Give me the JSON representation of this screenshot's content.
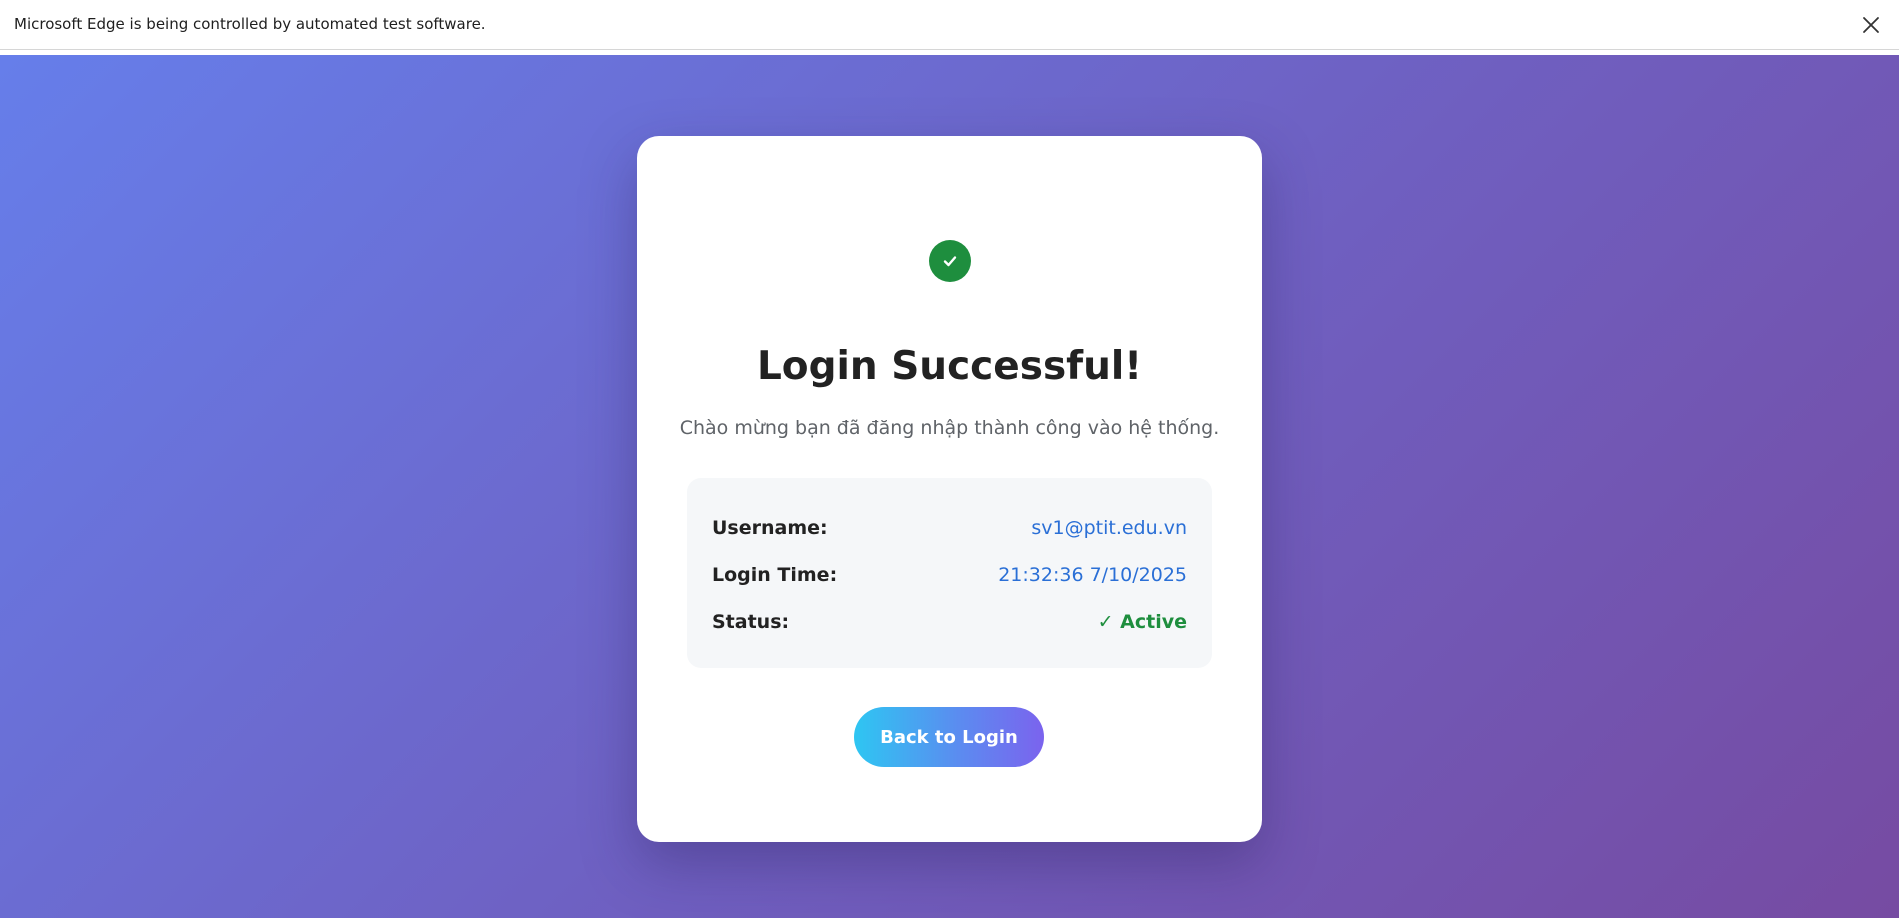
{
  "infobar": {
    "message": "Microsoft Edge is being controlled by automated test software.",
    "close_icon": "close-icon"
  },
  "colors": {
    "background_start": "#667eea",
    "background_end": "#764ba2",
    "success_green": "#1e8e3e",
    "value_blue": "#2a6fd6",
    "button_start": "#2ec6f2",
    "button_end": "#7b63ee"
  },
  "card": {
    "icon": "check-circle-icon",
    "title": "Login Successful!",
    "subtitle": "Chào mừng bạn đã đăng nhập thành công vào hệ thống.",
    "details": [
      {
        "label": "Username:",
        "value": "sv1@ptit.edu.vn"
      },
      {
        "label": "Login Time:",
        "value": "21:32:36 7/10/2025"
      },
      {
        "label": "Status:",
        "value": "✓ Active"
      }
    ],
    "back_button_label": "Back to Login"
  }
}
